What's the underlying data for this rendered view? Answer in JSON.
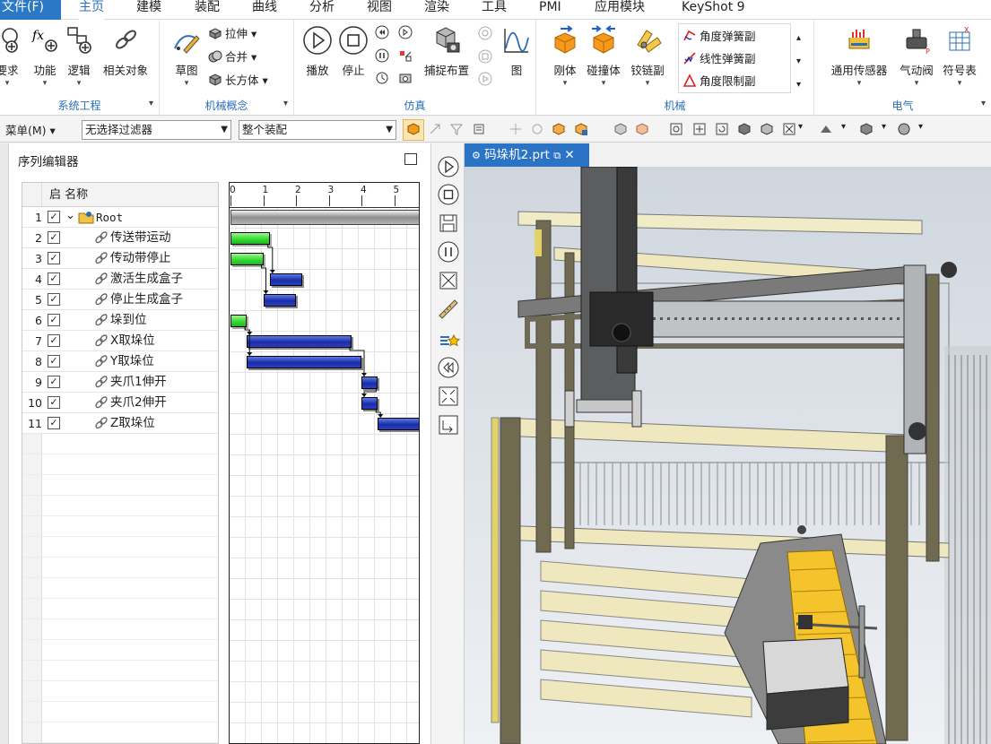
{
  "menubar": {
    "items": [
      "文件(F)",
      "主页",
      "建模",
      "装配",
      "曲线",
      "分析",
      "视图",
      "渲染",
      "工具",
      "PMI",
      "应用模块",
      "KeyShot 9"
    ]
  },
  "ribbon": {
    "groups": [
      {
        "title": "系统工程",
        "buttons": [
          "要求",
          "功能",
          "逻辑",
          "相关对象"
        ]
      },
      {
        "title": "机械概念",
        "buttons": [
          "草图"
        ],
        "small": [
          "拉伸",
          "合并",
          "长方体"
        ]
      },
      {
        "title": "仿真",
        "buttons": [
          "播放",
          "停止",
          "捕捉布置",
          "图"
        ]
      },
      {
        "title": "机械",
        "buttons": [
          "刚体",
          "碰撞体",
          "铰链副"
        ],
        "small": [
          "角度弹簧副",
          "线性弹簧副",
          "角度限制副"
        ]
      },
      {
        "title": "电气",
        "buttons": [
          "通用传感器",
          "气动阀",
          "符号表"
        ]
      }
    ]
  },
  "filterbar": {
    "menu_label": "菜单(M)",
    "filter_value": "无选择过滤器",
    "scope_value": "整个装配"
  },
  "sequence_editor": {
    "title": "序列编辑器",
    "col_enable": "启",
    "col_name": "名称",
    "rows": [
      {
        "num": "1",
        "name": "Root"
      },
      {
        "num": "2",
        "name": "传送带运动"
      },
      {
        "num": "3",
        "name": "传动带停止"
      },
      {
        "num": "4",
        "name": "激活生成盒子"
      },
      {
        "num": "5",
        "name": "停止生成盒子"
      },
      {
        "num": "6",
        "name": "垛到位"
      },
      {
        "num": "7",
        "name": "X取垛位"
      },
      {
        "num": "8",
        "name": "Y取垛位"
      },
      {
        "num": "9",
        "name": "夹爪1伸开"
      },
      {
        "num": "10",
        "name": "夹爪2伸开"
      },
      {
        "num": "11",
        "name": "Z取垛位"
      }
    ],
    "gantt": {
      "ticks": [
        "0",
        "1",
        "2",
        "3",
        "4",
        "5"
      ],
      "bars": [
        {
          "row": 1,
          "start": 0,
          "end": 5.8,
          "color": "gray"
        },
        {
          "row": 2,
          "start": 0,
          "end": 1.2,
          "color": "green"
        },
        {
          "row": 3,
          "start": 0,
          "end": 1.0,
          "color": "green"
        },
        {
          "row": 4,
          "start": 1.2,
          "end": 2.2,
          "color": "blue"
        },
        {
          "row": 5,
          "start": 1.0,
          "end": 2.0,
          "color": "blue"
        },
        {
          "row": 6,
          "start": 0,
          "end": 0.5,
          "color": "green"
        },
        {
          "row": 7,
          "start": 0.5,
          "end": 3.7,
          "color": "blue"
        },
        {
          "row": 8,
          "start": 0.5,
          "end": 4.0,
          "color": "blue"
        },
        {
          "row": 9,
          "start": 4.0,
          "end": 4.5,
          "color": "blue"
        },
        {
          "row": 10,
          "start": 4.0,
          "end": 4.5,
          "color": "blue"
        },
        {
          "row": 11,
          "start": 4.5,
          "end": 5.8,
          "color": "blue"
        }
      ]
    }
  },
  "viewport": {
    "tab_title": "码垛机2.prt"
  },
  "colors": {
    "accent": "#2a6fb8",
    "tab_blue": "#2b74c5",
    "bar_blue": "#1a2ca8",
    "bar_green": "#2fd82f",
    "frame_olive": "#6f6a50",
    "wood": "#efe7bd",
    "conveyor_yellow": "#f5c42c"
  }
}
